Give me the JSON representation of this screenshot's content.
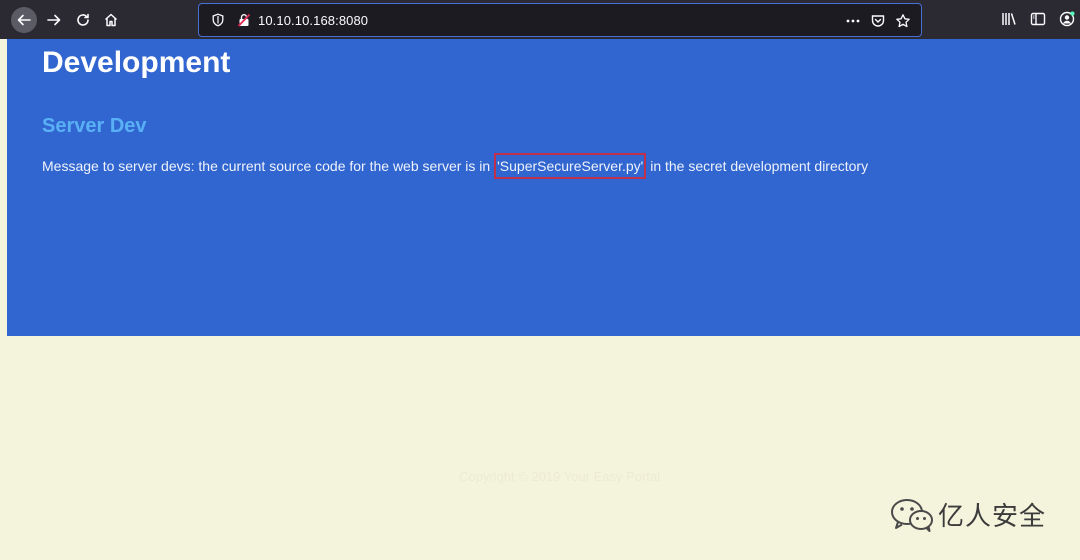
{
  "browser": {
    "url": "10.10.10.168:8080",
    "icons": [
      "back-icon",
      "forward-icon",
      "reload-icon",
      "home-icon",
      "shield-icon",
      "insecure-lock-icon",
      "more-dots-icon",
      "pocket-icon",
      "bookmark-star-icon",
      "library-icon",
      "sidebar-icon",
      "account-icon"
    ]
  },
  "page": {
    "title": "Development",
    "subtitle": "Server Dev",
    "message_before": "Message to server devs: the current source code for the web server is in ",
    "message_highlight": "'SuperSecureServer.py'",
    "message_after": " in the secret development directory",
    "footer": "Copyright © 2019 Your Easy Portal"
  },
  "watermark": {
    "text": "亿人安全"
  },
  "colors": {
    "hero_background": "#3166d0",
    "page_background": "#f4f4dc",
    "subtitle": "#59b0f5",
    "highlight_border": "#c0304a",
    "toolbar": "#2b2a33"
  }
}
